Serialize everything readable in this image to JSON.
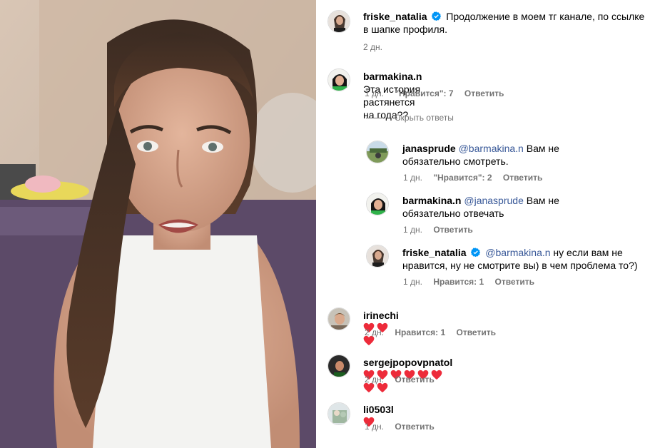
{
  "video": {
    "description_icon": "video-frame"
  },
  "comments": [
    {
      "user": "friske_natalia",
      "verified": true,
      "text": "Продолжение в моем тг канале, по ссылке в шапке профиля.",
      "time": "2 дн."
    },
    {
      "user": "barmakina.n",
      "text": "Эта история растянется на года??",
      "time": "1 дн.",
      "likes": "\"Нравится\": 7",
      "reply": "Ответить"
    }
  ],
  "hide_replies": "Скрыть ответы",
  "replies": [
    {
      "user": "janasprude",
      "mention": "@barmakina.n",
      "text": " Вам не обязательно смотреть.",
      "time": "1 дн.",
      "likes": "\"Нравится\": 2",
      "reply": "Ответить"
    },
    {
      "user": "barmakina.n",
      "mention": "@janasprude",
      "text": " Вам не обязательно отвечать",
      "time": "1 дн.",
      "reply": "Ответить"
    },
    {
      "user": "friske_natalia",
      "verified": true,
      "mention": "@barmakina.n",
      "text": " ну если вам не нравится, ну не смотрите вы) в чем проблема то?)",
      "time": "1 дн.",
      "likes": "Нравится: 1",
      "reply": "Ответить"
    }
  ],
  "more_comments": [
    {
      "user": "irinechi",
      "hearts": 3,
      "time": "2 дн.",
      "likes": "Нравится: 1",
      "reply": "Ответить"
    },
    {
      "user": "sergejpopovpnatol",
      "hearts": 8,
      "time": "2 дн.",
      "reply": "Ответить"
    },
    {
      "user": "li0503l",
      "hearts": 1,
      "time": "1 дн.",
      "reply": "Ответить"
    }
  ],
  "colors": {
    "verified": "#0095f6",
    "heart": "#ed2b3a",
    "mention": "#385898",
    "meta": "#737373"
  }
}
